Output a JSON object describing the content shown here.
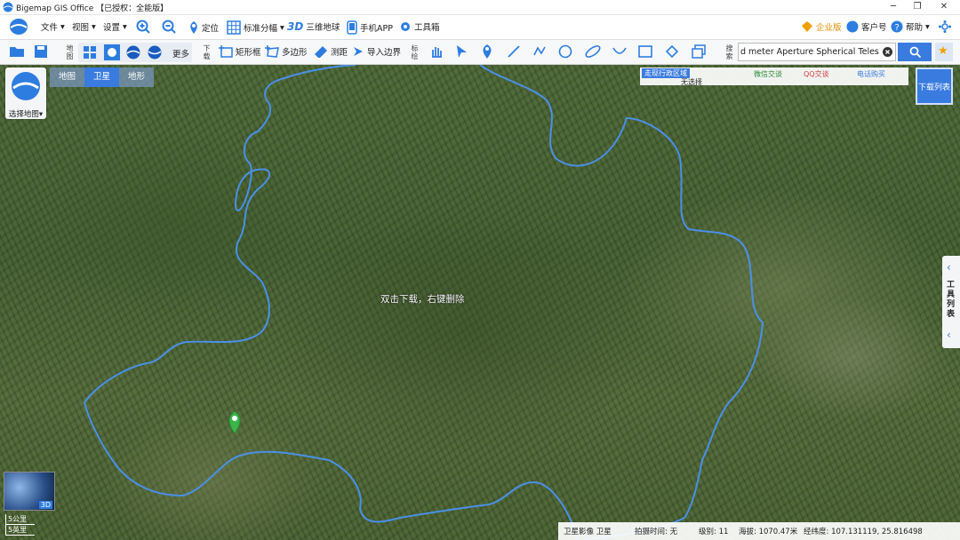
{
  "titlebar": {
    "title": "Bigemap GIS Office 【已授权：全能版】"
  },
  "menu": {
    "file": "文件",
    "view": "视图",
    "settings": "设置",
    "locate": "定位",
    "standard_sheet": "标准分幅",
    "three_d_icon": "3D",
    "three_d": "三维地球",
    "mobile_app": "手机APP",
    "toolbox": "工具箱",
    "enterprise": "企业版",
    "account": "客户号",
    "help": "帮助"
  },
  "toolbar": {
    "map_label": "地图",
    "more": "更多",
    "download_label": "下载",
    "rect": "矩形框",
    "polygon": "多边形",
    "measure": "测距",
    "import_boundary": "导入边界",
    "annotate_label": "标绘",
    "search_label": "搜索",
    "search_value": "d meter Aperture Spherical Telescope"
  },
  "map": {
    "tabs": [
      {
        "label": "地图"
      },
      {
        "label": "卫星"
      },
      {
        "label": "地形"
      }
    ],
    "select_map": "选择地图",
    "hint": "双击下载，右键删除",
    "download_list": "下载列表",
    "tool_list": [
      "工",
      "具",
      "列",
      "表"
    ],
    "panel_tabs": [
      "走现行政区域",
      "微信交谈",
      "QQ交谈",
      "电话购买"
    ],
    "panel_sub": "无选择",
    "minimap_badge": "3D",
    "scale": [
      "5公里",
      "5英里"
    ]
  },
  "status": {
    "layer": "卫星影像 卫星",
    "capture_time": "拍摄时间: 无",
    "level": "级别: 11",
    "elevation": "海拔: 1070.47米",
    "coords": "经纬度: 107.131119, 25.816498"
  },
  "colors": {
    "accent": "#3a7be0",
    "boundary": "#4a90e8",
    "marker": "#39b54a",
    "enterprise": "#f0a000"
  }
}
